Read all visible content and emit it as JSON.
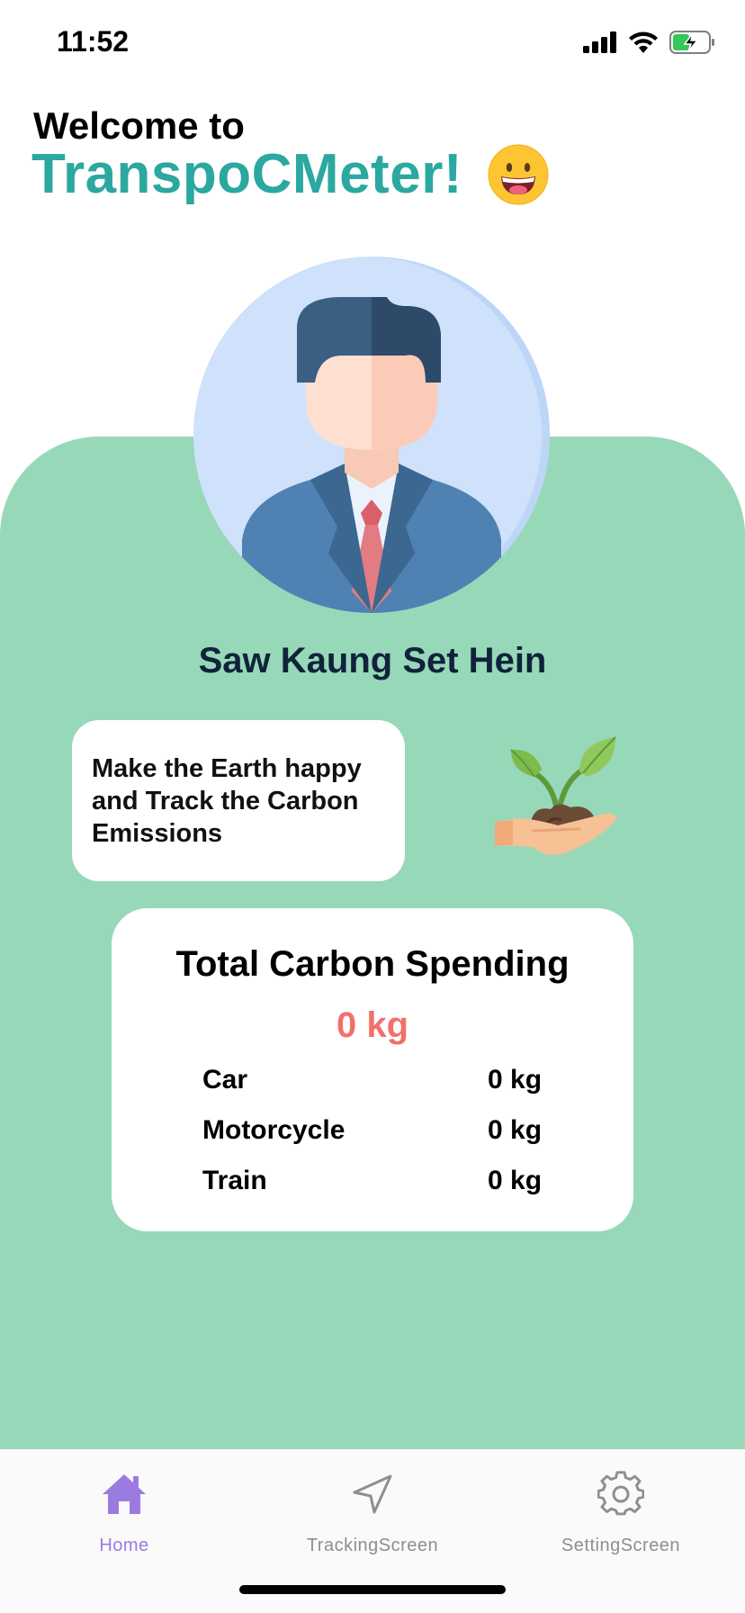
{
  "status_bar": {
    "time": "11:52",
    "icons": [
      "cellular-signal-icon",
      "wifi-icon",
      "battery-charging-icon"
    ]
  },
  "header": {
    "welcome": "Welcome to",
    "app_title": "TranspoCMeter!",
    "emoji": "grinning-face-icon"
  },
  "profile": {
    "name": "Saw Kaung Set Hein",
    "avatar": "businessman-avatar"
  },
  "motto": {
    "text": "Make the Earth happy and Track the Carbon Emissions",
    "illustration": "plant-in-hand-icon"
  },
  "summary": {
    "title": "Total Carbon Spending",
    "total": "0 kg",
    "rows": [
      {
        "label": "Car",
        "value": "0 kg"
      },
      {
        "label": "Motorcycle",
        "value": "0 kg"
      },
      {
        "label": "Train",
        "value": "0 kg"
      }
    ]
  },
  "tabs": [
    {
      "label": "Home",
      "icon": "home-icon",
      "active": true
    },
    {
      "label": "TrackingScreen",
      "icon": "navigation-arrow-icon",
      "active": false
    },
    {
      "label": "SettingScreen",
      "icon": "gear-icon",
      "active": false
    }
  ],
  "colors": {
    "brand_teal": "#2ba89f",
    "panel_green": "#97d8b9",
    "total_red": "#f2706b",
    "tab_active": "#9c7be0",
    "tab_inactive": "#8e8e93"
  }
}
